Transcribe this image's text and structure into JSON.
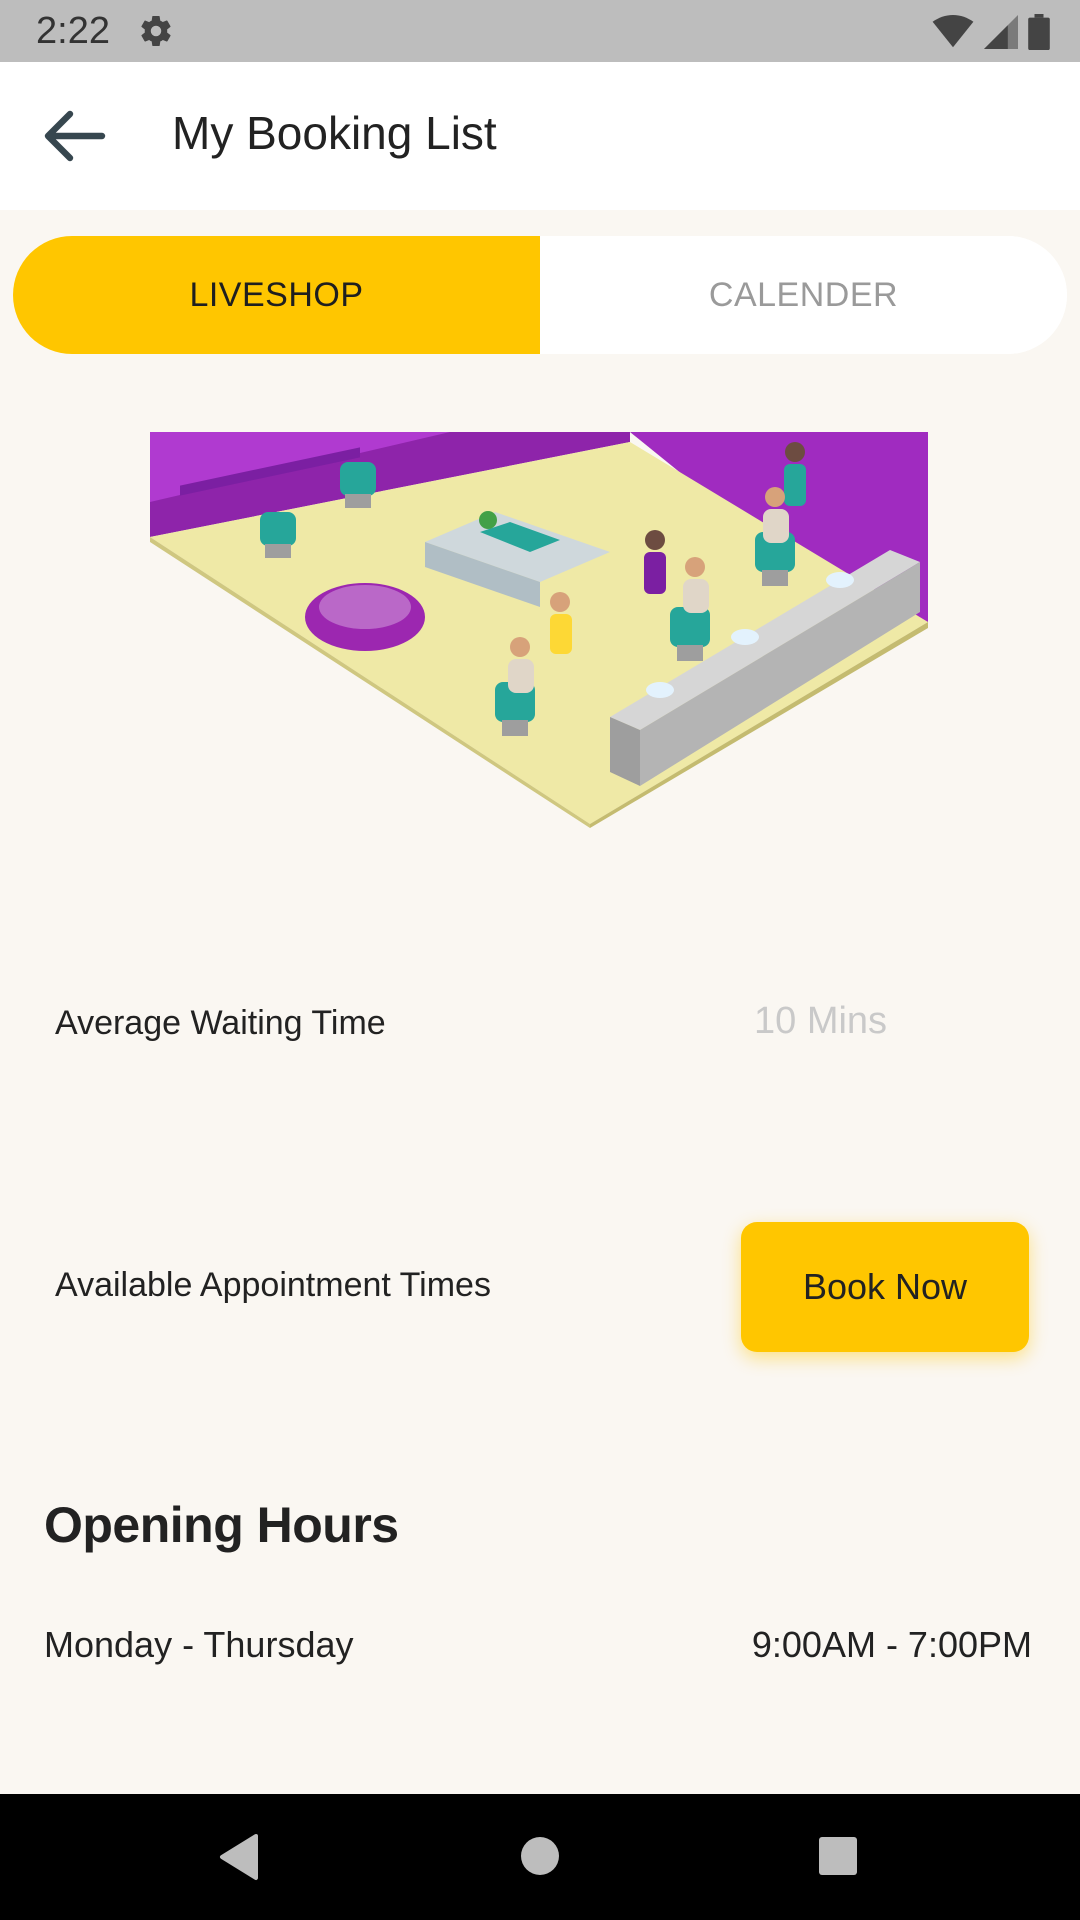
{
  "status_bar": {
    "time": "2:22",
    "icons": [
      "settings-icon",
      "wifi-icon",
      "signal-icon",
      "battery-icon"
    ]
  },
  "app_bar": {
    "title": "My Booking List",
    "back_icon": "arrow-left-icon"
  },
  "tabs": [
    {
      "label": "LIVESHOP",
      "active": true
    },
    {
      "label": "CALENDER",
      "active": false
    }
  ],
  "illustration": {
    "description_icon": "barbershop-illustration"
  },
  "waiting": {
    "label": "Average Waiting Time",
    "value": "10 Mins"
  },
  "appointment": {
    "label": "Available Appointment Times",
    "button_label": "Book Now"
  },
  "opening_hours": {
    "title": "Opening Hours",
    "rows": [
      {
        "days": "Monday - Thursday",
        "hours": "9:00AM - 7:00PM"
      }
    ]
  },
  "colors": {
    "accent": "#ffc600",
    "background": "#faf7f2",
    "muted": "#9a9a9a"
  },
  "nav_bar": {
    "icons": [
      "back-triangle-icon",
      "home-circle-icon",
      "recents-square-icon"
    ]
  }
}
